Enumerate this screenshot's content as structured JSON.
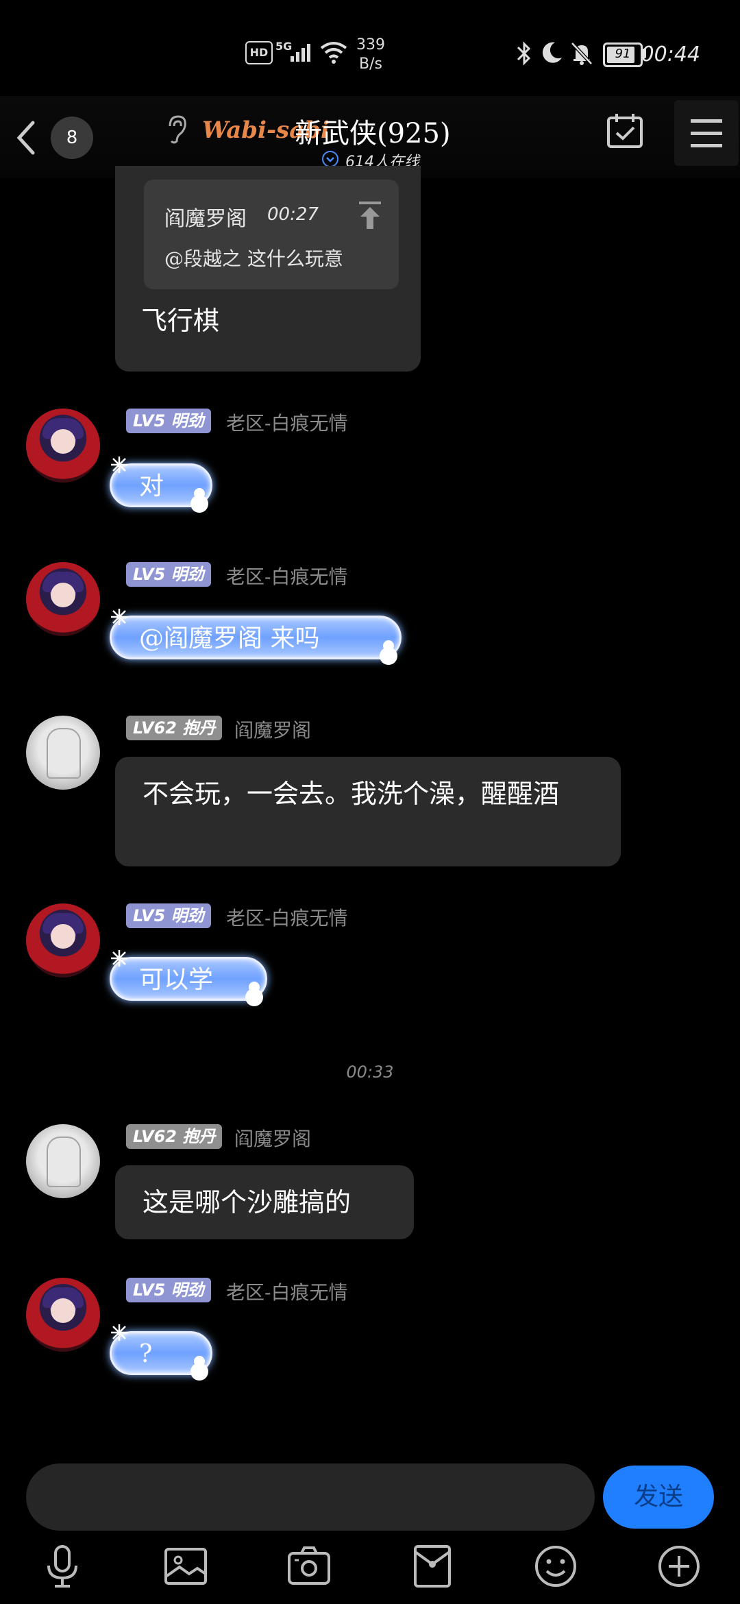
{
  "status_bar": {
    "net_label": "HD",
    "signal_label": "5G",
    "speed_value": "339",
    "speed_unit": "B/s",
    "battery": "91",
    "time": "00:44"
  },
  "header": {
    "unread_count": "8",
    "brand": "Wabi-sabi",
    "group_name": "新武侠(925)",
    "online": "614人在线"
  },
  "messages": {
    "quoted": {
      "author": "阎魔罗阁",
      "time": "00:27",
      "text": "@段越之 这什么玩意",
      "reply": "飞行棋"
    },
    "m1": {
      "level": "LV5 明劲",
      "name": "老区-白痕无情",
      "text": "对"
    },
    "m2": {
      "level": "LV5 明劲",
      "name": "老区-白痕无情",
      "text": "@阎魔罗阁 来吗"
    },
    "m3": {
      "level": "LV62 抱丹",
      "name": "阎魔罗阁",
      "text": "不会玩，一会去。我洗个澡，醒醒酒"
    },
    "m4": {
      "level": "LV5 明劲",
      "name": "老区-白痕无情",
      "text": "可以学"
    },
    "timestamp": "00:33",
    "m5": {
      "level": "LV62 抱丹",
      "name": "阎魔罗阁",
      "text": "这是哪个沙雕搞的"
    },
    "m6": {
      "level": "LV5 明劲",
      "name": "老区-白痕无情",
      "text": "?"
    }
  },
  "input": {
    "placeholder": "",
    "send_label": "发送"
  },
  "toolbar": {
    "icons": [
      "microphone-icon",
      "image-icon",
      "camera-icon",
      "red-packet-icon",
      "emoji-icon",
      "plus-icon"
    ]
  },
  "colors": {
    "send": "#1f7fff",
    "level_purple": "#8e95d2",
    "level_gray": "#8f8f8f"
  }
}
